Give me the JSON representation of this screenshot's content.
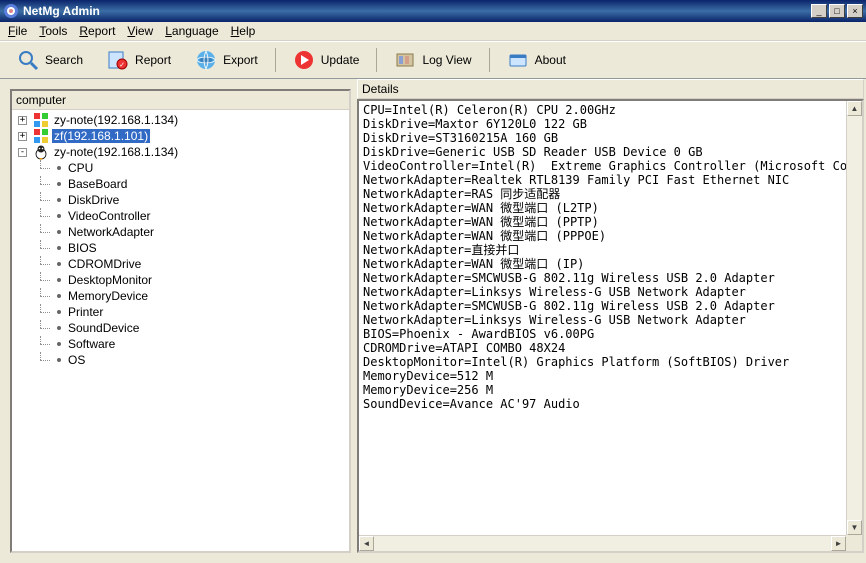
{
  "window": {
    "title": "NetMg Admin"
  },
  "menu": {
    "file": "File",
    "tools": "Tools",
    "report": "Report",
    "view": "View",
    "language": "Language",
    "help": "Help"
  },
  "toolbar": {
    "search": "Search",
    "report": "Report",
    "export": "Export",
    "update": "Update",
    "logview": "Log View",
    "about": "About"
  },
  "tree": {
    "header": "computer",
    "nodes": [
      {
        "label": "zy-note(192.168.1.134)",
        "icon": "windows",
        "expander": "+"
      },
      {
        "label": "zf(192.168.1.101)",
        "icon": "windows",
        "expander": "+",
        "selected": true
      },
      {
        "label": "zy-note(192.168.1.134)",
        "icon": "linux",
        "expander": "-"
      }
    ],
    "children": [
      "CPU",
      "BaseBoard",
      "DiskDrive",
      "VideoController",
      "NetworkAdapter",
      "BIOS",
      "CDROMDrive",
      "DesktopMonitor",
      "MemoryDevice",
      "Printer",
      "SoundDevice",
      "Software",
      "OS"
    ]
  },
  "details": {
    "header": "Details",
    "lines": [
      "CPU=Intel(R) Celeron(R) CPU 2.00GHz",
      "DiskDrive=Maxtor 6Y120L0 122 GB",
      "DiskDrive=ST3160215A 160 GB",
      "DiskDrive=Generic USB SD Reader USB Device 0 GB",
      "VideoController=Intel(R)  Extreme Graphics Controller (Microsoft Corporation)",
      "NetworkAdapter=Realtek RTL8139 Family PCI Fast Ethernet NIC",
      "NetworkAdapter=RAS 同步适配器",
      "NetworkAdapter=WAN 微型端口 (L2TP)",
      "NetworkAdapter=WAN 微型端口 (PPTP)",
      "NetworkAdapter=WAN 微型端口 (PPPOE)",
      "NetworkAdapter=直接并口",
      "NetworkAdapter=WAN 微型端口 (IP)",
      "NetworkAdapter=SMCWUSB-G 802.11g Wireless USB 2.0 Adapter",
      "NetworkAdapter=Linksys Wireless-G USB Network Adapter",
      "NetworkAdapter=SMCWUSB-G 802.11g Wireless USB 2.0 Adapter",
      "NetworkAdapter=Linksys Wireless-G USB Network Adapter",
      "BIOS=Phoenix - AwardBIOS v6.00PG",
      "CDROMDrive=ATAPI COMBO 48X24",
      "DesktopMonitor=Intel(R) Graphics Platform (SoftBIOS) Driver",
      "MemoryDevice=512 M",
      "MemoryDevice=256 M",
      "SoundDevice=Avance AC'97 Audio"
    ]
  }
}
